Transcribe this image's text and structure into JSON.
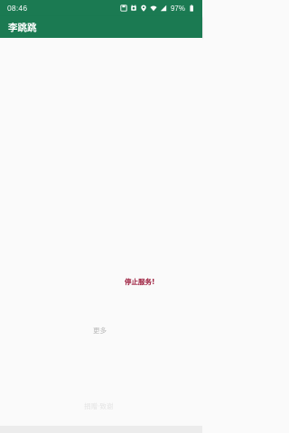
{
  "status_bar": {
    "time": "08:46",
    "battery": "97%",
    "icons": [
      "save-icon",
      "alarm-icon",
      "location-icon",
      "wifi-icon",
      "signal-icon",
      "battery-icon"
    ]
  },
  "app_bar": {
    "title": "李跳跳"
  },
  "main": {
    "stop_service_label": "停止服务!",
    "more_label": "更多",
    "footer_label": "捐赠·致谢"
  },
  "colors": {
    "primary": "#1b7a52",
    "accent": "#9b1a3a",
    "background": "#fafafa"
  }
}
